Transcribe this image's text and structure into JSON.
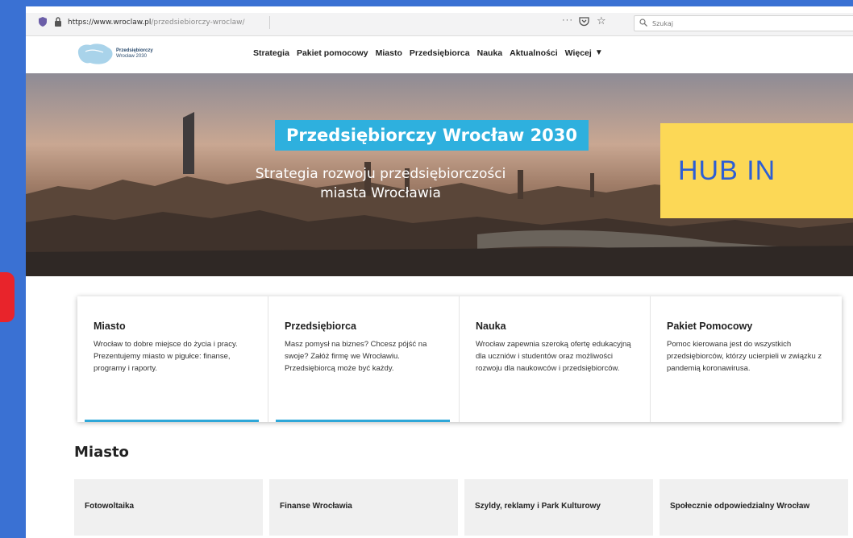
{
  "browser": {
    "url_host": "https://www.wroclaw.pl",
    "url_path": "/przedsiebiorczy-wroclaw/",
    "more": "···",
    "search_placeholder": "Szukaj"
  },
  "logo": {
    "line1": "Przedsiębiorczy",
    "line2": "Wrocław 2030"
  },
  "nav": {
    "items": [
      "Strategia",
      "Pakiet pomocowy",
      "Miasto",
      "Przedsiębiorca",
      "Nauka",
      "Aktualności",
      "Więcej"
    ],
    "more_caret": "▼"
  },
  "hero": {
    "title": "Przedsiębiorczy Wrocław 2030",
    "subtitle_line1": "Strategia rozwoju przedsiębiorczości",
    "subtitle_line2": "miasta Wrocławia"
  },
  "overlay": {
    "hub_text": "HUB IN"
  },
  "cards": [
    {
      "title": "Miasto",
      "text": "Wrocław to dobre miejsce do życia i pracy. Prezentujemy miasto w pigułce: finanse, programy i raporty.",
      "active": true
    },
    {
      "title": "Przedsiębiorca",
      "text": "Masz pomysł na biznes? Chcesz pójść na swoje? Załóż firmę we Wrocławiu. Przedsiębiorcą może być każdy.",
      "active": true
    },
    {
      "title": "Nauka",
      "text": "Wrocław zapewnia szeroką ofertę edukacyjną dla uczniów i studentów oraz możliwości rozwoju dla naukowców i przedsiębiorców.",
      "active": false
    },
    {
      "title": "Pakiet Pomocowy",
      "text": "Pomoc kierowana jest do wszystkich przedsiębiorców, którzy ucierpieli w związku z pandemią koronawirusa.",
      "active": false
    }
  ],
  "section": {
    "title": "Miasto",
    "tiles": [
      "Fotowoltaika",
      "Finanse Wrocławia",
      "Szyldy, reklamy i Park Kulturowy",
      "Społecznie odpowiedzialny Wrocław"
    ]
  },
  "colors": {
    "background": "#3a71d3",
    "accent_blue": "#2eb0de",
    "hub_yellow": "#fcd856",
    "hub_text": "#2d5ed4",
    "red_tab": "#e8242b"
  }
}
